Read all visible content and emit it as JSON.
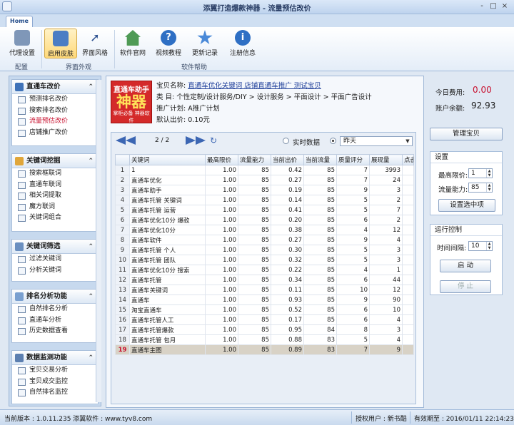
{
  "window": {
    "title": "添翼打造爆款神器 - 流量预估改价",
    "min": "-",
    "max": "□",
    "close": "×"
  },
  "ribbon": {
    "tab": "Home",
    "buttons": [
      {
        "label": "代理设置",
        "icon": "proxy-icon"
      },
      {
        "label": "启用皮肤",
        "icon": "skin-icon"
      },
      {
        "label": "界面风格",
        "icon": "cursor-icon"
      },
      {
        "label": "软件官网",
        "icon": "home-icon"
      },
      {
        "label": "视频教程",
        "icon": "help-icon"
      },
      {
        "label": "更新记录",
        "icon": "star-icon"
      },
      {
        "label": "注册信息",
        "icon": "info-icon"
      }
    ],
    "groups": [
      "配置",
      "界面外观",
      "软件帮助"
    ]
  },
  "sidebar": {
    "sections": [
      {
        "title": "直通车改价",
        "items": [
          "预测排名改价",
          "搜索排名改价",
          "流量预估改价",
          "店铺推广改价"
        ]
      },
      {
        "title": "关键词挖掘",
        "items": [
          "搜索框联词",
          "直通车联词",
          "相关词提取",
          "魔方联词",
          "关键词组合"
        ]
      },
      {
        "title": "关键词筛选",
        "items": [
          "过滤关键词",
          "分析关键词"
        ]
      },
      {
        "title": "排名分析功能",
        "items": [
          "自然排名分析",
          "直通车分析",
          "历史数据查看"
        ]
      },
      {
        "title": "数据监测功能",
        "items": [
          "宝贝交易分析",
          "宝贝成交监控",
          "自然排名监控"
        ]
      }
    ]
  },
  "product": {
    "logo": {
      "line1": "直通车助手",
      "line2": "神器",
      "line3": "掌柜必备 神器软件"
    },
    "name_label": "宝贝名称:",
    "name": "直通车优化关键词 店铺直通车推广  测试宝贝",
    "category_label": "类    目:",
    "category": "个性定制/设计服务/DIY > 设计服务 > 平面设计 > 平面广告设计",
    "plan_label": "推广计划:",
    "plan": "A推广计划",
    "price_label": "默认出价:",
    "price": "0.10元"
  },
  "account": {
    "today_label": "今日费用:",
    "today": "0.00",
    "balance_label": "账户余额:",
    "balance": "92.93",
    "manage_btn": "管理宝贝"
  },
  "pager": {
    "page": "2 / 2",
    "realtime": "实时数据",
    "period": "昨天"
  },
  "grid": {
    "columns": [
      "",
      "关键词",
      "最高限价",
      "流量能力",
      "当前出价",
      "当前流量",
      "质量评分",
      "展现量",
      "点击"
    ],
    "rows": [
      [
        "1",
        "1",
        "1.00",
        "85",
        "0.42",
        "85",
        "7",
        "3993",
        ""
      ],
      [
        "2",
        "直通车优化",
        "1.00",
        "85",
        "0.27",
        "85",
        "7",
        "24",
        ""
      ],
      [
        "3",
        "直通车助手",
        "1.00",
        "85",
        "0.19",
        "85",
        "9",
        "3",
        ""
      ],
      [
        "4",
        "直通车托管 关键词",
        "1.00",
        "85",
        "0.14",
        "85",
        "5",
        "2",
        ""
      ],
      [
        "5",
        "直通车托管 运营",
        "1.00",
        "85",
        "0.41",
        "85",
        "5",
        "7",
        ""
      ],
      [
        "6",
        "直通车优化10分 爆款",
        "1.00",
        "85",
        "0.20",
        "85",
        "6",
        "2",
        ""
      ],
      [
        "7",
        "直通车优化10分",
        "1.00",
        "85",
        "0.38",
        "85",
        "4",
        "12",
        ""
      ],
      [
        "8",
        "直通车软件",
        "1.00",
        "85",
        "0.27",
        "85",
        "9",
        "4",
        ""
      ],
      [
        "9",
        "直通车托管 个人",
        "1.00",
        "85",
        "0.30",
        "85",
        "5",
        "3",
        ""
      ],
      [
        "10",
        "直通车托管 团队",
        "1.00",
        "85",
        "0.32",
        "85",
        "5",
        "3",
        ""
      ],
      [
        "11",
        "直通车优化10分 搜索",
        "1.00",
        "85",
        "0.22",
        "85",
        "4",
        "1",
        ""
      ],
      [
        "12",
        "直通车托管",
        "1.00",
        "85",
        "0.34",
        "85",
        "6",
        "44",
        ""
      ],
      [
        "13",
        "直通车关键词",
        "1.00",
        "85",
        "0.11",
        "85",
        "10",
        "12",
        ""
      ],
      [
        "14",
        "直通车",
        "1.00",
        "85",
        "0.93",
        "85",
        "9",
        "90",
        ""
      ],
      [
        "15",
        "淘宝直通车",
        "1.00",
        "85",
        "0.52",
        "85",
        "6",
        "10",
        ""
      ],
      [
        "16",
        "直通车托管人工",
        "1.00",
        "85",
        "0.17",
        "85",
        "6",
        "4",
        ""
      ],
      [
        "17",
        "直通车托管爆款",
        "1.00",
        "85",
        "0.95",
        "84",
        "8",
        "3",
        ""
      ],
      [
        "18",
        "直通车托管 包月",
        "1.00",
        "85",
        "0.88",
        "83",
        "5",
        "4",
        ""
      ],
      [
        "19",
        "直通车主图",
        "1.00",
        "85",
        "0.89",
        "83",
        "7",
        "9",
        ""
      ]
    ]
  },
  "settings": {
    "title": "设置",
    "max_price_label": "最高限价:",
    "max_price": "1",
    "traffic_label": "流量能力:",
    "traffic": "85",
    "apply_btn": "设置选中项"
  },
  "run": {
    "title": "运行控制",
    "interval_label": "时间间隔:",
    "interval": "10",
    "start_btn": "启  动",
    "stop_btn": "停  止"
  },
  "status": {
    "version": "当前版本 : 1.0.11.235 添翼软件 : www.tyv8.com",
    "license": "授权用户 : 新书酷",
    "expiry": "有效期至 : 2016/01/11 22:14:23"
  },
  "colors": {
    "accent": "#c8102e",
    "link": "#1f3f9a",
    "nav": "#3c66b3"
  }
}
